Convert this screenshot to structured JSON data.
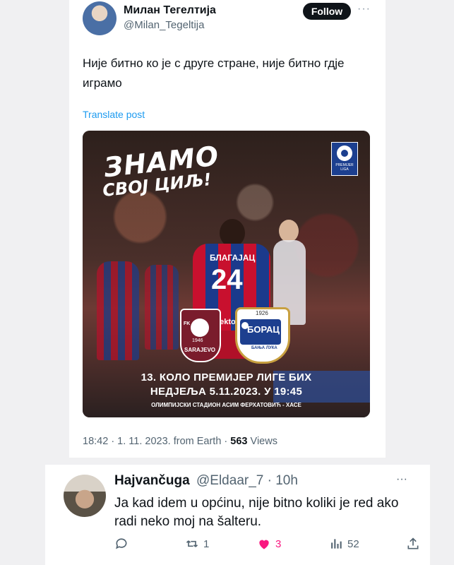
{
  "tweet": {
    "author_name": "Милан Тегелтија",
    "author_handle": "@Milan_Tegeltija",
    "follow_label": "Follow",
    "more_label": "···",
    "text": "Није битно ко је с друге стране, није битно гдје играмо",
    "translate_label": "Translate post",
    "time": "18:42 · 1. 11. 2023. from Earth · ",
    "views_count": "563",
    "views_label": " Views"
  },
  "poster": {
    "title_line1": "ЗНАМО",
    "title_line2": "СВОЈ ЦИЉ!",
    "league_text": "PREMIJER LIGA",
    "shirt_name": "БЛАГАЈАЦ",
    "shirt_number": "24",
    "shirt_sponsor": "sektor",
    "home_fk": "FK",
    "home_year": "1946",
    "home_name": "SARAJEVO",
    "away_year": "1926",
    "away_name": "БОРАЦ",
    "away_city": "БАЊА ЛУКА",
    "round": "13. КОЛО ПРЕМИЈЕР ЛИГЕ БИХ",
    "date": "НЕДЈЕЉА 5.11.2023. У 19:45",
    "venue": "ОЛИМПИЈСКИ СТАДИОН АСИМ ФЕРХАТОВИЋ - ХАСЕ"
  },
  "reply": {
    "name": "Hajvančuga",
    "handle_time": "@Eldaar_7 · 10h",
    "more_label": "···",
    "text": "Ja kad idem u općinu, nije bitno koliki je red ako radi neko moj na šalteru.",
    "retweets": "1",
    "likes": "3",
    "views": "52"
  },
  "colors": {
    "accent": "#1d9bf0",
    "like": "#f91880",
    "muted": "#536471"
  }
}
